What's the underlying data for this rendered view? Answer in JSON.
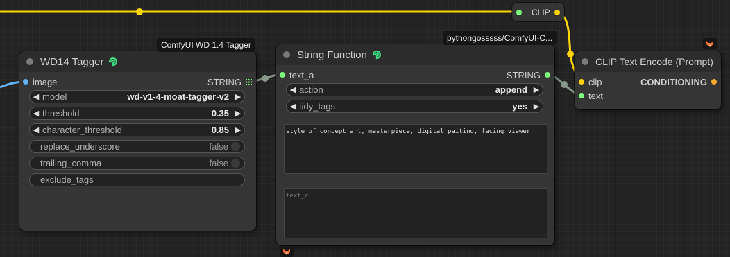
{
  "reroute_node": {
    "label": "CLIP"
  },
  "wd14_tagger": {
    "badge": "ComfyUI WD 1.4 Tagger",
    "title": "WD14 Tagger",
    "input_label": "image",
    "output_label": "STRING",
    "widgets": {
      "model": {
        "label": "model",
        "value": "wd-v1-4-moat-tagger-v2"
      },
      "threshold": {
        "label": "threshold",
        "value": "0.35"
      },
      "character_threshold": {
        "label": "character_threshold",
        "value": "0.85"
      },
      "replace_underscore": {
        "label": "replace_underscore",
        "value": "false"
      },
      "trailing_comma": {
        "label": "trailing_comma",
        "value": "false"
      },
      "exclude_tags": {
        "label": "exclude_tags"
      }
    }
  },
  "string_function": {
    "badge": "pythongosssss/ComfyUI-C...",
    "title": "String Function",
    "input_label": "text_a",
    "output_label": "STRING",
    "widgets": {
      "action": {
        "label": "action",
        "value": "append"
      },
      "tidy_tags": {
        "label": "tidy_tags",
        "value": "yes"
      }
    },
    "text_b": "style of concept art, masterpiece, digital paiting, facing viewer",
    "text_c_placeholder": "text_c"
  },
  "clip_text_encode": {
    "title": "CLIP Text Encode (Prompt)",
    "inputs": {
      "clip": "clip",
      "text": "text"
    },
    "output_label": "CONDITIONING"
  },
  "colors": {
    "clip_wire": "#ffd500",
    "string_wire": "#889988",
    "image_wire": "#64b5f6",
    "slot_string": "#7cff7c",
    "slot_clip": "#ffd500",
    "slot_conditioning": "#ffa931",
    "python_icon": "#3ddc84",
    "fox_icon": "#f06a25"
  }
}
